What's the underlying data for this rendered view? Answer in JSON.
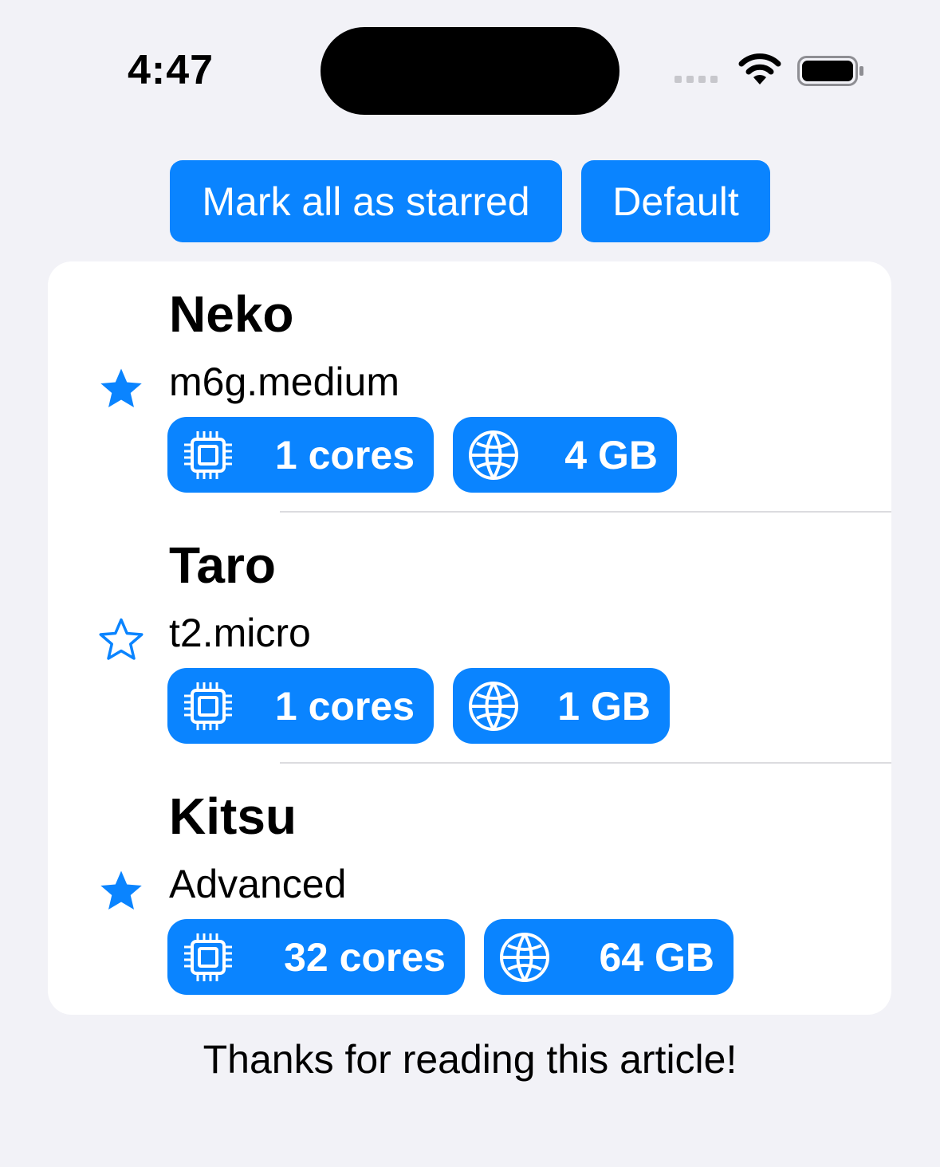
{
  "status_bar": {
    "time": "4:47"
  },
  "toolbar": {
    "mark_all_label": "Mark all as starred",
    "default_label": "Default"
  },
  "servers": [
    {
      "name": "Neko",
      "type": "m6g.medium",
      "starred": true,
      "cores": "1 cores",
      "memory": "4 GB"
    },
    {
      "name": "Taro",
      "type": "t2.micro",
      "starred": false,
      "cores": "1 cores",
      "memory": "1 GB"
    },
    {
      "name": "Kitsu",
      "type": "Advanced",
      "starred": true,
      "cores": "32 cores",
      "memory": "64 GB"
    }
  ],
  "icons": {
    "star_filled": "star-filled-icon",
    "star_outline": "star-outline-icon",
    "cpu": "cpu-icon",
    "memory": "globe-icon"
  },
  "colors": {
    "accent": "#0a84ff",
    "background": "#f2f2f7",
    "card": "#ffffff"
  },
  "footer": {
    "text": "Thanks for reading this article!"
  }
}
